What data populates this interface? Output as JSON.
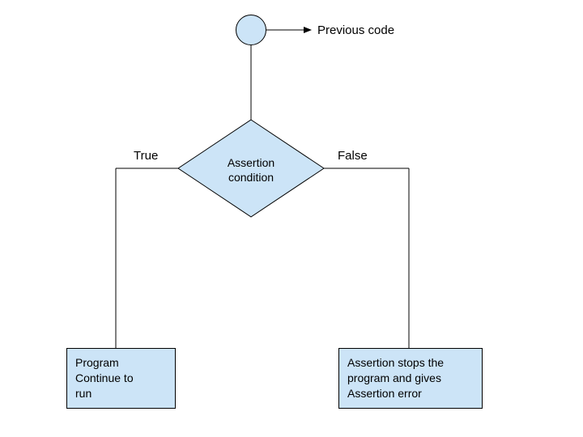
{
  "nodes": {
    "start_label": "Previous code",
    "decision": "Assertion condition",
    "true_branch_label": "True",
    "false_branch_label": "False",
    "true_outcome_line1": "Program",
    "true_outcome_line2": "Continue to",
    "true_outcome_line3": "run",
    "false_outcome_line1": "Assertion stops the",
    "false_outcome_line2": "program and gives",
    "false_outcome_line3": "Assertion error"
  },
  "colors": {
    "fill": "#cce4f7",
    "stroke": "#000000"
  }
}
